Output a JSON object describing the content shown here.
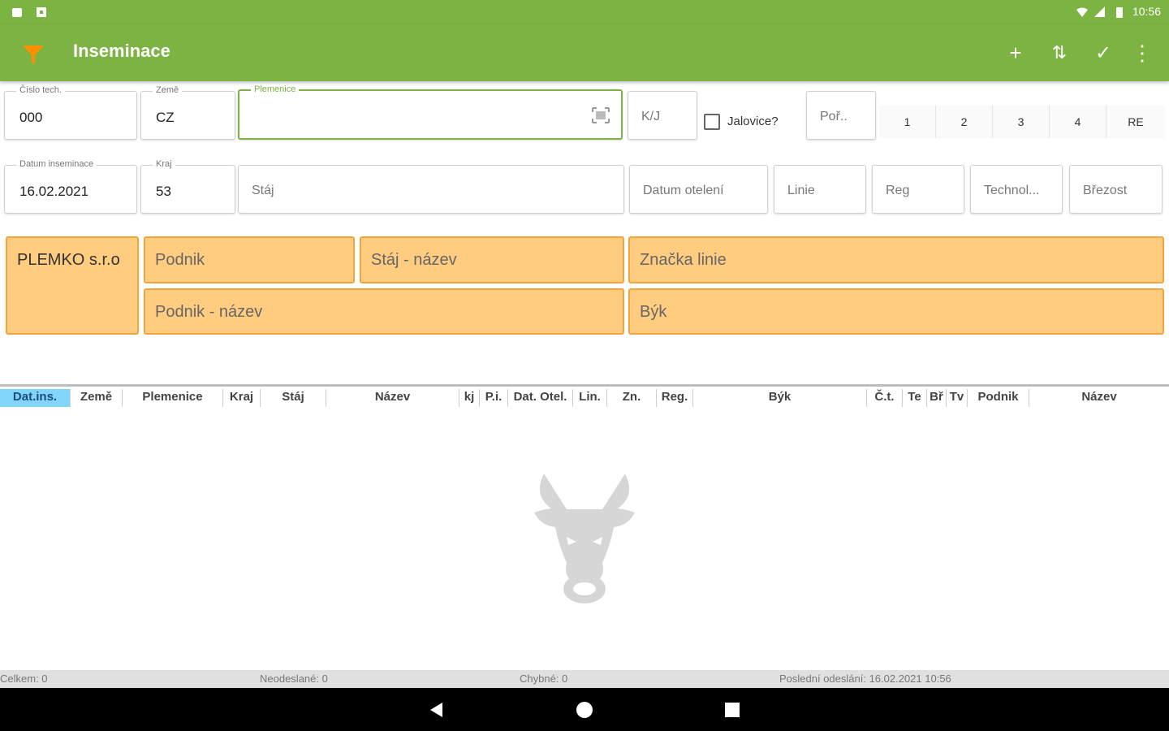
{
  "statusbar": {
    "time": "10:56"
  },
  "appbar": {
    "title": "Inseminace",
    "actions": {
      "add": "+",
      "sort": "⇅",
      "confirm": "✓",
      "more": "⋮"
    }
  },
  "form_row1": {
    "cislo_tech": {
      "label": "Číslo tech.",
      "value": "000"
    },
    "zeme": {
      "label": "Země",
      "value": "CZ"
    },
    "plemenice": {
      "label": "Plemenice",
      "value": ""
    },
    "kj_placeholder": "K/J",
    "jalovice_label": "Jalovice?",
    "poradi_placeholder": "Poř..",
    "number_buttons": [
      "1",
      "2",
      "3",
      "4",
      "RE"
    ]
  },
  "form_row2": {
    "datum_inseminace": {
      "label": "Datum inseminace",
      "value": "16.02.2021"
    },
    "kraj": {
      "label": "Kraj",
      "value": "53"
    },
    "staj_placeholder": "Stáj",
    "datum_oteleni_placeholder": "Datum otelení",
    "linie_placeholder": "Linie",
    "reg_placeholder": "Reg",
    "technol_placeholder": "Technol...",
    "brezost_placeholder": "Březost"
  },
  "info_cards": {
    "company": "PLEMKO s.r.o",
    "podnik": "Podnik",
    "staj_nazev": "Stáj - název",
    "znacka_linie": "Značka linie",
    "podnik_nazev": "Podnik - název",
    "byk": "Býk"
  },
  "table": {
    "headers": [
      "Dat.ins.",
      "Země",
      "Plemenice",
      "Kraj",
      "Stáj",
      "Název",
      "kj",
      "P.i.",
      "Dat. Otel.",
      "Lin.",
      "Zn.",
      "Reg.",
      "Býk",
      "Č.t.",
      "Te",
      "Bř",
      "Tv",
      "Podnik",
      "Název"
    ]
  },
  "footer": {
    "celkem": "Celkem: 0",
    "neodeslane": "Neodeslané: 0",
    "chybne": "Chybné: 0",
    "posledni": "Poslední odeslání: 16.02.2021 10:56"
  },
  "colors": {
    "primary": "#7cb342",
    "card": "#ffcc80",
    "card_border": "#f3a43a",
    "selected_header": "#81d4fa"
  },
  "icons": [
    "filter-logo-icon",
    "add-icon",
    "sort-icon",
    "check-icon",
    "more-icon",
    "barcode-icon",
    "bull-icon",
    "back-icon",
    "home-icon",
    "recents-icon"
  ]
}
